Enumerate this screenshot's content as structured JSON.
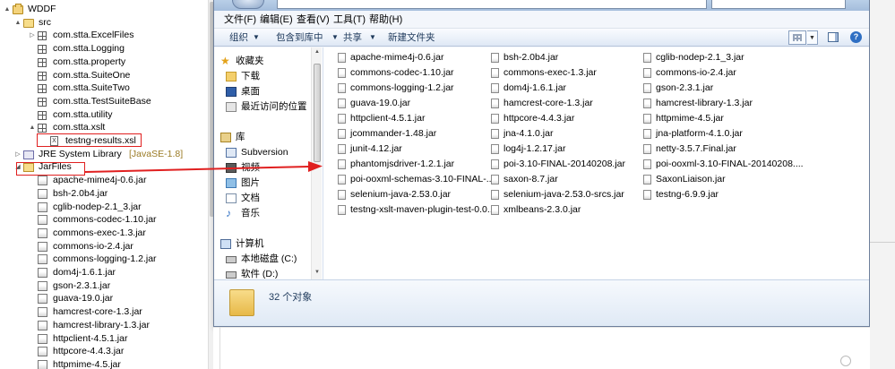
{
  "tree": {
    "items": [
      {
        "label": "WDDF",
        "icon": "project-icon",
        "twisty": "▲",
        "indent": 0
      },
      {
        "label": "src",
        "icon": "source-folder-icon",
        "twisty": "▲",
        "indent": 1
      },
      {
        "label": "com.stta.ExcelFiles",
        "icon": "package-icon",
        "twisty": "▷",
        "indent": 2
      },
      {
        "label": "com.stta.Logging",
        "icon": "package-icon",
        "twisty": "",
        "indent": 2
      },
      {
        "label": "com.stta.property",
        "icon": "package-icon",
        "twisty": "",
        "indent": 2
      },
      {
        "label": "com.stta.SuiteOne",
        "icon": "package-icon",
        "twisty": "",
        "indent": 2
      },
      {
        "label": "com.stta.SuiteTwo",
        "icon": "package-icon",
        "twisty": "",
        "indent": 2
      },
      {
        "label": "com.stta.TestSuiteBase",
        "icon": "package-icon",
        "twisty": "",
        "indent": 2
      },
      {
        "label": "com.stta.utility",
        "icon": "package-icon",
        "twisty": "",
        "indent": 2
      },
      {
        "label": "com.stta.xslt",
        "icon": "package-icon",
        "twisty": "▲",
        "indent": 2
      },
      {
        "label": "testng-results.xsl",
        "icon": "xsl-file-icon",
        "twisty": "",
        "indent": 3
      },
      {
        "label": "JRE System Library",
        "icon": "jre-library-icon",
        "twisty": "▷",
        "indent": 1,
        "tag": "[JavaSE-1.8]"
      },
      {
        "label": "JarFiles",
        "icon": "jar-folder-icon",
        "twisty": "◢",
        "indent": 1
      },
      {
        "label": "apache-mime4j-0.6.jar",
        "icon": "jar-icon",
        "twisty": "",
        "indent": 2
      },
      {
        "label": "bsh-2.0b4.jar",
        "icon": "jar-icon",
        "twisty": "",
        "indent": 2
      },
      {
        "label": "cglib-nodep-2.1_3.jar",
        "icon": "jar-icon",
        "twisty": "",
        "indent": 2
      },
      {
        "label": "commons-codec-1.10.jar",
        "icon": "jar-icon",
        "twisty": "",
        "indent": 2
      },
      {
        "label": "commons-exec-1.3.jar",
        "icon": "jar-icon",
        "twisty": "",
        "indent": 2
      },
      {
        "label": "commons-io-2.4.jar",
        "icon": "jar-icon",
        "twisty": "",
        "indent": 2
      },
      {
        "label": "commons-logging-1.2.jar",
        "icon": "jar-icon",
        "twisty": "",
        "indent": 2
      },
      {
        "label": "dom4j-1.6.1.jar",
        "icon": "jar-icon",
        "twisty": "",
        "indent": 2
      },
      {
        "label": "gson-2.3.1.jar",
        "icon": "jar-icon",
        "twisty": "",
        "indent": 2
      },
      {
        "label": "guava-19.0.jar",
        "icon": "jar-icon",
        "twisty": "",
        "indent": 2
      },
      {
        "label": "hamcrest-core-1.3.jar",
        "icon": "jar-icon",
        "twisty": "",
        "indent": 2
      },
      {
        "label": "hamcrest-library-1.3.jar",
        "icon": "jar-icon",
        "twisty": "",
        "indent": 2
      },
      {
        "label": "httpclient-4.5.1.jar",
        "icon": "jar-icon",
        "twisty": "",
        "indent": 2
      },
      {
        "label": "httpcore-4.4.3.jar",
        "icon": "jar-icon",
        "twisty": "",
        "indent": 2
      },
      {
        "label": "httpmime-4.5.jar",
        "icon": "jar-icon",
        "twisty": "",
        "indent": 2
      }
    ]
  },
  "explorer": {
    "menu": [
      "文件(F)",
      "编辑(E)",
      "查看(V)",
      "工具(T)",
      "帮助(H)"
    ],
    "toolbar": [
      "组织",
      "包含到库中",
      "共享",
      "新建文件夹"
    ],
    "help_glyph": "?",
    "nav": [
      {
        "label": "收藏夹",
        "icon": "favorites-star-icon"
      },
      {
        "label": "下载",
        "icon": "downloads-folder-icon"
      },
      {
        "label": "桌面",
        "icon": "desktop-icon"
      },
      {
        "label": "最近访问的位置",
        "icon": "recent-places-icon"
      },
      {
        "label": "库",
        "icon": "libraries-icon"
      },
      {
        "label": "Subversion",
        "icon": "subversion-icon"
      },
      {
        "label": "视频",
        "icon": "videos-icon"
      },
      {
        "label": "图片",
        "icon": "pictures-icon"
      },
      {
        "label": "文档",
        "icon": "documents-icon"
      },
      {
        "label": "音乐",
        "icon": "music-icon"
      },
      {
        "label": "计算机",
        "icon": "computer-icon"
      },
      {
        "label": "本地磁盘 (C:)",
        "icon": "local-disk-icon"
      },
      {
        "label": "软件 (D:)",
        "icon": "drive-icon"
      }
    ],
    "files": [
      "apache-mime4j-0.6.jar",
      "bsh-2.0b4.jar",
      "cglib-nodep-2.1_3.jar",
      "commons-codec-1.10.jar",
      "commons-exec-1.3.jar",
      "commons-io-2.4.jar",
      "commons-logging-1.2.jar",
      "dom4j-1.6.1.jar",
      "gson-2.3.1.jar",
      "guava-19.0.jar",
      "hamcrest-core-1.3.jar",
      "hamcrest-library-1.3.jar",
      "httpclient-4.5.1.jar",
      "httpcore-4.4.3.jar",
      "httpmime-4.5.jar",
      "jcommander-1.48.jar",
      "jna-4.1.0.jar",
      "jna-platform-4.1.0.jar",
      "junit-4.12.jar",
      "log4j-1.2.17.jar",
      "netty-3.5.7.Final.jar",
      "phantomjsdriver-1.2.1.jar",
      "poi-3.10-FINAL-20140208.jar",
      "poi-ooxml-3.10-FINAL-20140208....",
      "poi-ooxml-schemas-3.10-FINAL-...",
      "saxon-8.7.jar",
      "SaxonLiaison.jar",
      "selenium-java-2.53.0.jar",
      "selenium-java-2.53.0-srcs.jar",
      "testng-6.9.9.jar",
      "testng-xslt-maven-plugin-test-0.0....",
      "xmlbeans-2.3.0.jar"
    ],
    "status": "32 个对象"
  },
  "colors": {
    "annotation_red": "#e02020",
    "window_frame": "#6d7f9b",
    "toolbar_text": "#1e395b"
  }
}
